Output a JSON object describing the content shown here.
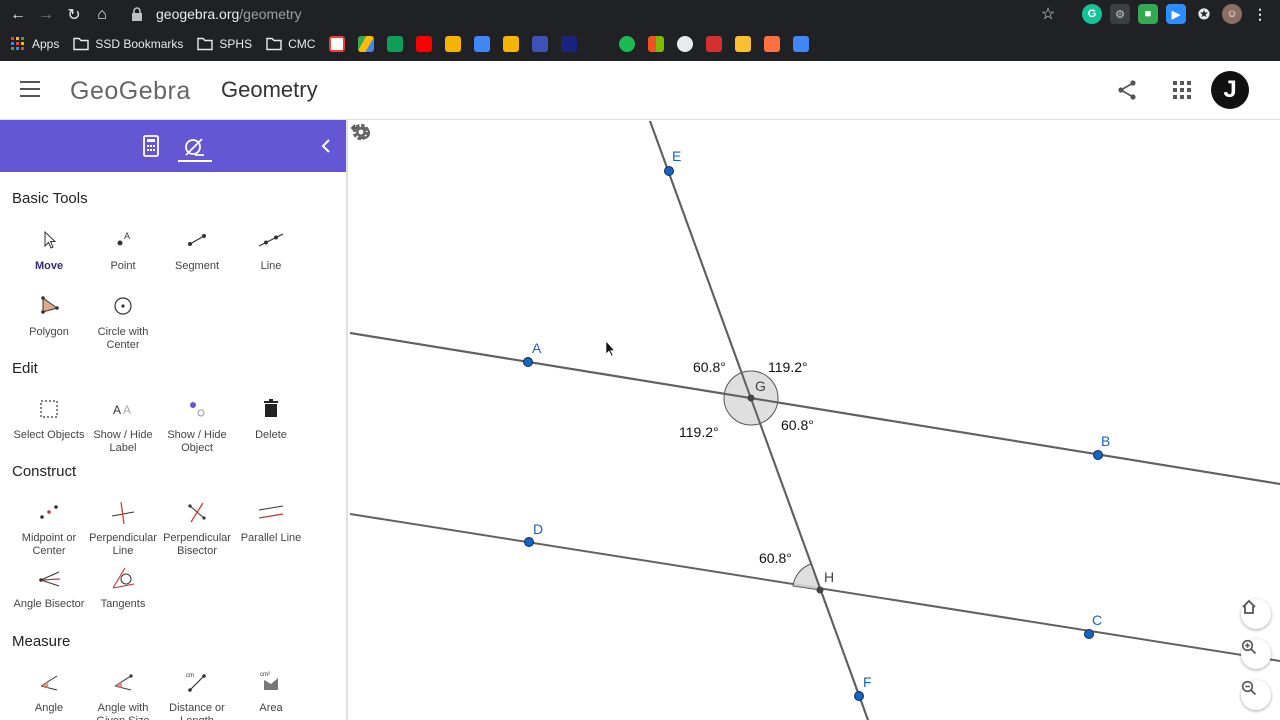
{
  "browser": {
    "url_host": "geogebra.org",
    "url_path": "/geometry",
    "bookmarks": [
      "Apps",
      "SSD Bookmarks",
      "SPHS",
      "CMC"
    ]
  },
  "header": {
    "logo": "GeoGebra",
    "title": "Geometry",
    "avatar_letter": "J"
  },
  "sidebar": {
    "sections": [
      {
        "title": "Basic Tools",
        "tools": [
          "Move",
          "Point",
          "Segment",
          "Line",
          "Polygon",
          "Circle with Center"
        ]
      },
      {
        "title": "Edit",
        "tools": [
          "Select Objects",
          "Show / Hide Label",
          "Show / Hide Object",
          "Delete"
        ]
      },
      {
        "title": "Construct",
        "tools": [
          "Midpoint or Center",
          "Perpendicular Line",
          "Perpendicular Bisector",
          "Parallel Line",
          "Angle Bisector",
          "Tangents"
        ]
      },
      {
        "title": "Measure",
        "tools": [
          "Angle",
          "Angle with Given Size",
          "Distance or Length",
          "Area"
        ]
      }
    ]
  },
  "canvas": {
    "points": [
      {
        "label": "A"
      },
      {
        "label": "B"
      },
      {
        "label": "C"
      },
      {
        "label": "D"
      },
      {
        "label": "E"
      },
      {
        "label": "F"
      },
      {
        "label": "G"
      },
      {
        "label": "H"
      }
    ],
    "angles": [
      "60.8°",
      "119.2°",
      "119.2°",
      "60.8°",
      "60.8°"
    ],
    "colors": {
      "point": "#1565c0",
      "line": "#616161",
      "accent": "#6556d4"
    }
  }
}
